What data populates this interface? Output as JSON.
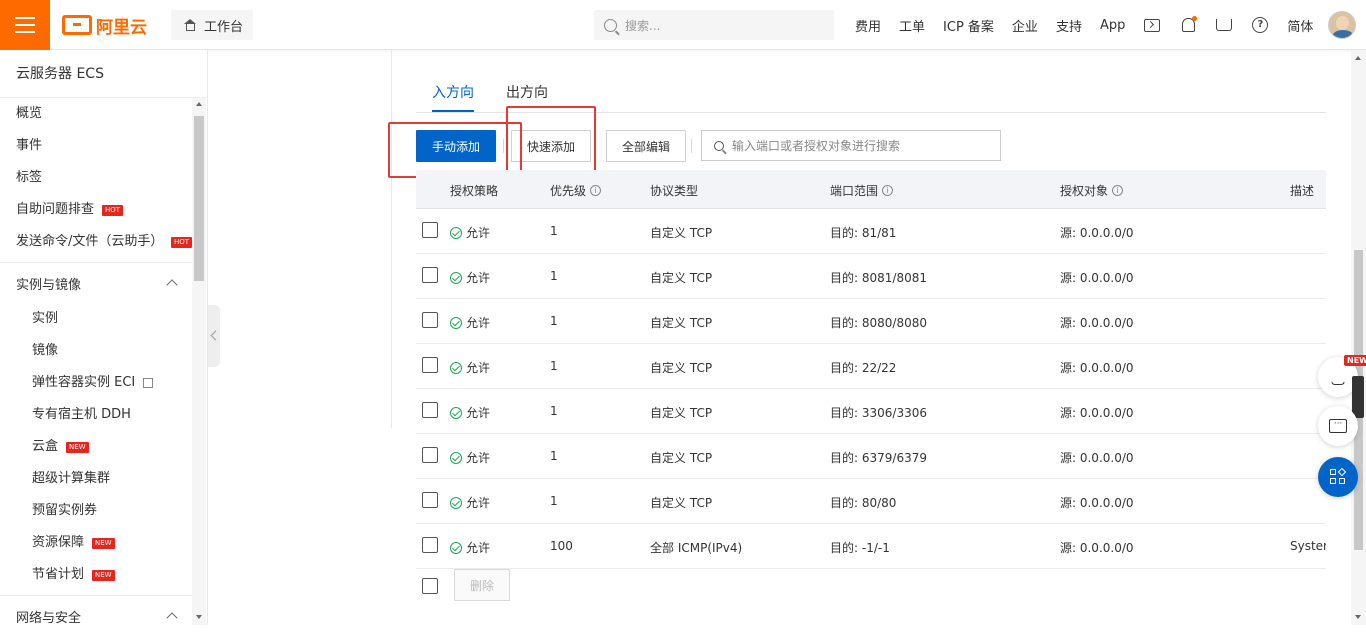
{
  "header": {
    "brand": "阿里云",
    "workbench_label": "工作台",
    "search_placeholder": "搜索...",
    "nav": [
      "费用",
      "工单",
      "ICP 备案",
      "企业",
      "支持",
      "App"
    ],
    "lang_label": "简体",
    "brand_color": "#ff6a00"
  },
  "sidebar": {
    "title": "云服务器 ECS",
    "top_items": [
      {
        "label": "概览"
      },
      {
        "label": "事件"
      },
      {
        "label": "标签"
      },
      {
        "label": "自助问题排查",
        "badge": "HOT"
      },
      {
        "label": "发送命令/文件（云助手）",
        "badge": "HOT"
      }
    ],
    "group_instances": "实例与镜像",
    "sub_items": [
      {
        "label": "实例"
      },
      {
        "label": "镜像"
      },
      {
        "label": "弹性容器实例 ECI"
      },
      {
        "label": "专有宿主机 DDH"
      },
      {
        "label": "云盒",
        "badge": "NEW"
      },
      {
        "label": "超级计算集群"
      },
      {
        "label": "预留实例券"
      },
      {
        "label": "资源保障",
        "badge": "NEW"
      },
      {
        "label": "节省计划",
        "badge": "NEW"
      }
    ],
    "group_network": "网络与安全"
  },
  "tabs": {
    "inbound": "入方向",
    "outbound": "出方向"
  },
  "toolbar": {
    "manual_add": "手动添加",
    "quick_add": "快速添加",
    "edit_all": "全部编辑",
    "search_placeholder": "输入端口或者授权对象进行搜索"
  },
  "table": {
    "columns": {
      "policy": "授权策略",
      "priority": "优先级",
      "protocol": "协议类型",
      "port_range": "端口范围",
      "auth_object": "授权对象",
      "description": "描述"
    },
    "rows": [
      {
        "policy": "允许",
        "priority": "1",
        "protocol": "自定义 TCP",
        "port": "目的: 81/81",
        "source": "源: 0.0.0.0/0",
        "desc": ""
      },
      {
        "policy": "允许",
        "priority": "1",
        "protocol": "自定义 TCP",
        "port": "目的: 8081/8081",
        "source": "源: 0.0.0.0/0",
        "desc": ""
      },
      {
        "policy": "允许",
        "priority": "1",
        "protocol": "自定义 TCP",
        "port": "目的: 8080/8080",
        "source": "源: 0.0.0.0/0",
        "desc": ""
      },
      {
        "policy": "允许",
        "priority": "1",
        "protocol": "自定义 TCP",
        "port": "目的: 22/22",
        "source": "源: 0.0.0.0/0",
        "desc": ""
      },
      {
        "policy": "允许",
        "priority": "1",
        "protocol": "自定义 TCP",
        "port": "目的: 3306/3306",
        "source": "源: 0.0.0.0/0",
        "desc": ""
      },
      {
        "policy": "允许",
        "priority": "1",
        "protocol": "自定义 TCP",
        "port": "目的: 6379/6379",
        "source": "源: 0.0.0.0/0",
        "desc": ""
      },
      {
        "policy": "允许",
        "priority": "1",
        "protocol": "自定义 TCP",
        "port": "目的: 80/80",
        "source": "源: 0.0.0.0/0",
        "desc": ""
      },
      {
        "policy": "允许",
        "priority": "100",
        "protocol": "全部 ICMP(IPv4)",
        "port": "目的: -1/-1",
        "source": "源: 0.0.0.0/0",
        "desc": "System"
      }
    ],
    "delete_label": "删除"
  },
  "widgets": {
    "new_tag": "NEW"
  },
  "colors": {
    "primary": "#0064c8",
    "highlight": "#e53935",
    "allow": "#1fa84f"
  }
}
